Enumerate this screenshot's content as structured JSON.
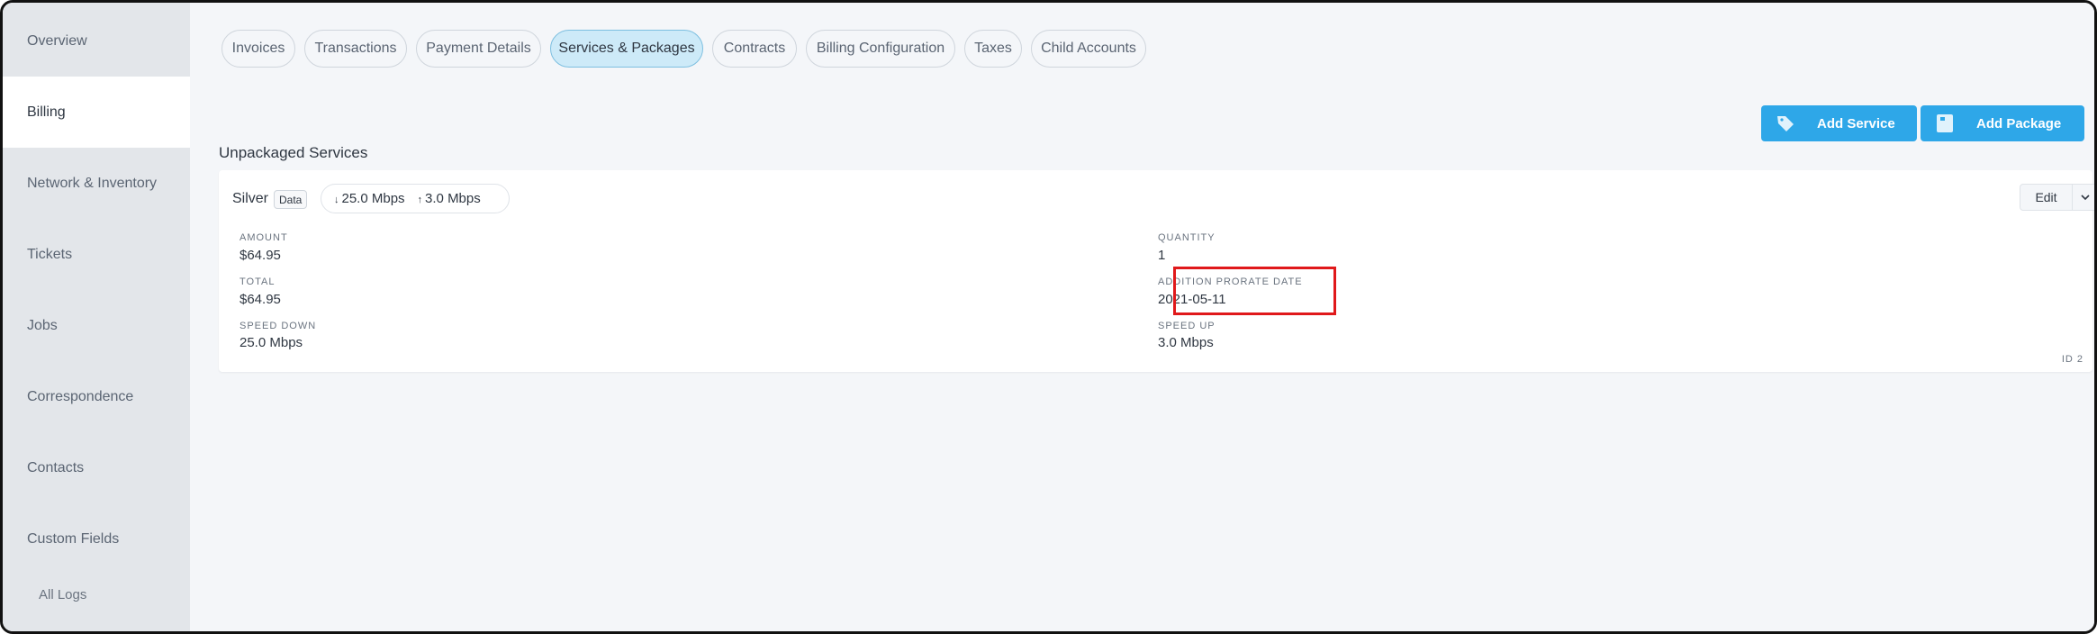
{
  "sidebar": {
    "items": [
      {
        "label": "Overview",
        "active": false
      },
      {
        "label": "Billing",
        "active": true
      },
      {
        "label": "Network & Inventory",
        "active": false
      },
      {
        "label": "Tickets",
        "active": false
      },
      {
        "label": "Jobs",
        "active": false
      },
      {
        "label": "Correspondence",
        "active": false
      },
      {
        "label": "Contacts",
        "active": false
      },
      {
        "label": "Custom Fields",
        "active": false
      }
    ],
    "sub_item": "All Logs"
  },
  "tabs": [
    {
      "label": "Invoices",
      "active": false
    },
    {
      "label": "Transactions",
      "active": false
    },
    {
      "label": "Payment Details",
      "active": false
    },
    {
      "label": "Services & Packages",
      "active": true
    },
    {
      "label": "Contracts",
      "active": false
    },
    {
      "label": "Billing Configuration",
      "active": false
    },
    {
      "label": "Taxes",
      "active": false
    },
    {
      "label": "Child Accounts",
      "active": false
    }
  ],
  "actions": {
    "add_service": "Add Service",
    "add_package": "Add Package"
  },
  "section_title": "Unpackaged Services",
  "service": {
    "name": "Silver",
    "badge": "Data",
    "speed_down": "25.0 Mbps",
    "speed_up": "3.0 Mbps",
    "edit_label": "Edit",
    "fields": {
      "amount_label": "AMOUNT",
      "amount": "$64.95",
      "total_label": "TOTAL",
      "total": "$64.95",
      "speed_down_label": "SPEED DOWN",
      "speed_down_value": "25.0 Mbps",
      "quantity_label": "QUANTITY",
      "quantity": "1",
      "prorate_label": "ADDITION PRORATE DATE",
      "prorate_date": "2021-05-11",
      "speed_up_label": "SPEED UP",
      "speed_up_value": "3.0 Mbps"
    },
    "id_label": "ID 2"
  },
  "colors": {
    "accent": "#2ea7e8",
    "highlight": "#e0191b",
    "active_tab_bg": "#cdeaf8"
  }
}
